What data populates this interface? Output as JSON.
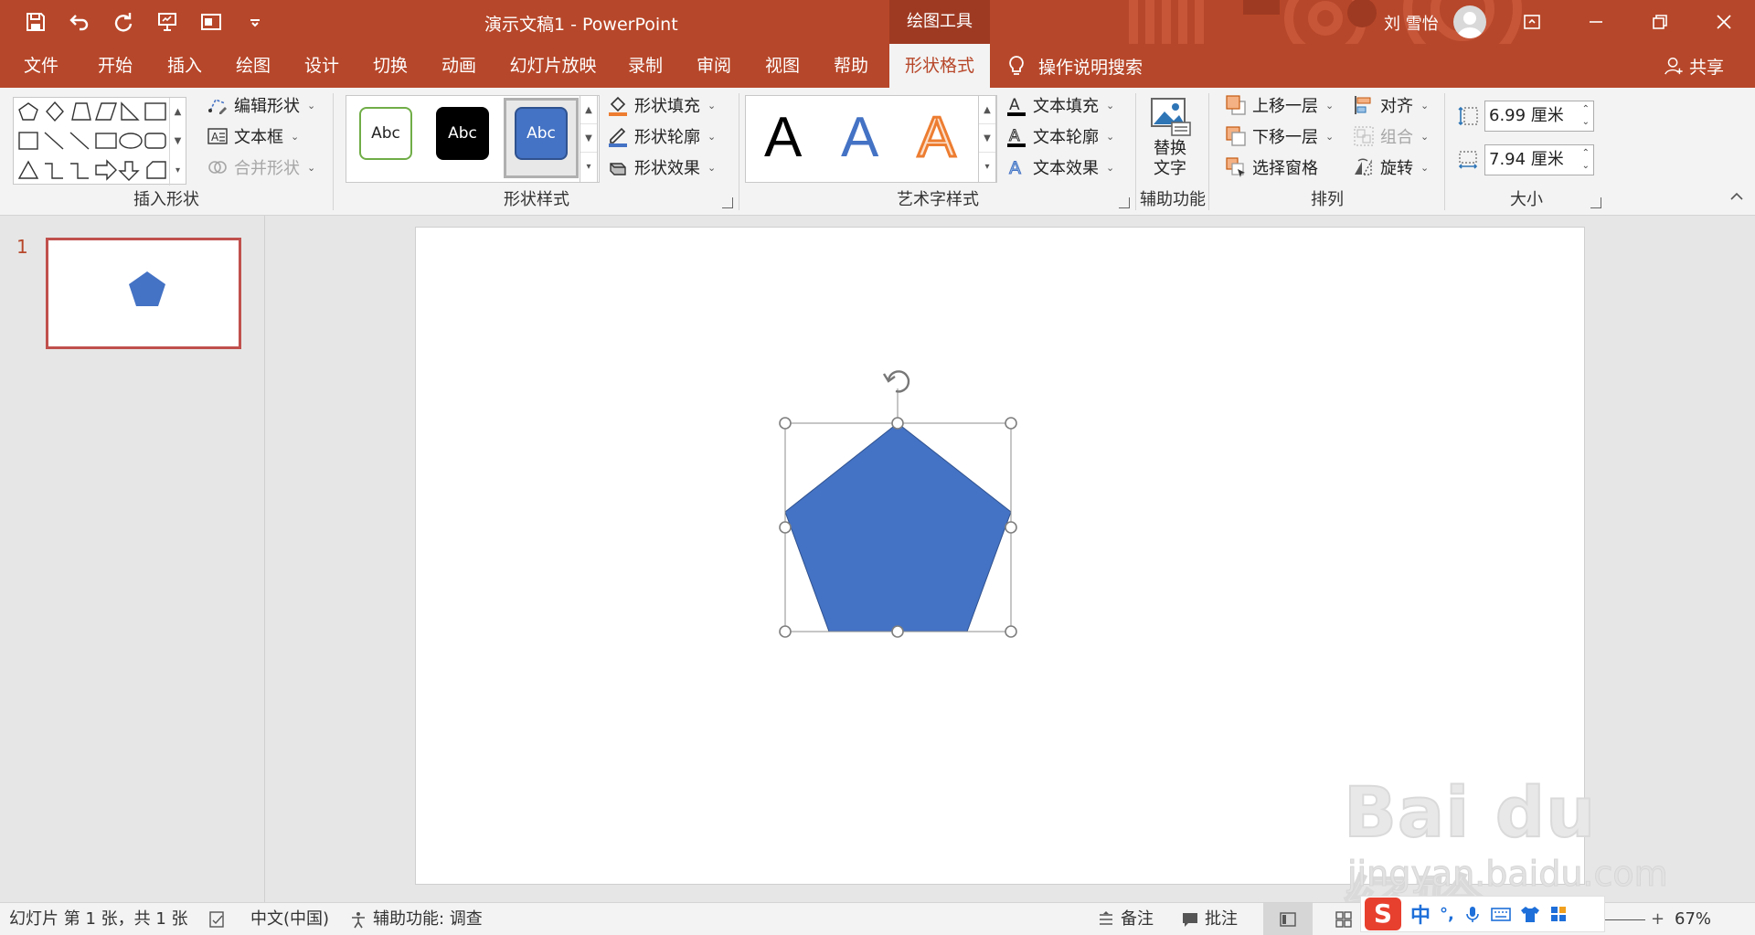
{
  "window": {
    "title": "演示文稿1  -  PowerPoint",
    "contextual_tab_group": "绘图工具",
    "user_name": "刘 雪怡"
  },
  "tabs": [
    {
      "label": "文件"
    },
    {
      "label": "开始"
    },
    {
      "label": "插入"
    },
    {
      "label": "绘图"
    },
    {
      "label": "设计"
    },
    {
      "label": "切换"
    },
    {
      "label": "动画"
    },
    {
      "label": "幻灯片放映"
    },
    {
      "label": "录制"
    },
    {
      "label": "审阅"
    },
    {
      "label": "视图"
    },
    {
      "label": "帮助"
    },
    {
      "label": "形状格式",
      "active": true
    }
  ],
  "tell_me": "操作说明搜索",
  "share": "共享",
  "ribbon": {
    "insert_shapes": {
      "label": "插入形状",
      "edit_shape": "编辑形状",
      "text_box": "文本框",
      "merge_shapes": "合并形状"
    },
    "shape_styles": {
      "label": "形状样式",
      "swatch_text": "Abc",
      "fill": "形状填充",
      "outline": "形状轮廓",
      "effects": "形状效果"
    },
    "wordart_styles": {
      "label": "艺术字样式",
      "letter": "A",
      "text_fill": "文本填充",
      "text_outline": "文本轮廓",
      "text_effects": "文本效果"
    },
    "accessibility": {
      "label": "辅助功能",
      "alt_text_line1": "替换",
      "alt_text_line2": "文字"
    },
    "arrange": {
      "label": "排列",
      "bring_forward": "上移一层",
      "send_backward": "下移一层",
      "selection_pane": "选择窗格",
      "align": "对齐",
      "group": "组合",
      "rotate": "旋转"
    },
    "size": {
      "label": "大小",
      "height": "6.99 厘米",
      "width": "7.94 厘米"
    }
  },
  "thumbnails": [
    {
      "number": "1"
    }
  ],
  "status": {
    "slide_info": "幻灯片 第 1 张，共 1 张",
    "language": "中文(中国)",
    "accessibility": "辅助功能: 调查",
    "notes": "备注",
    "comments": "批注",
    "zoom": "67%"
  },
  "ime": {
    "mode": "中",
    "punct": "°,"
  },
  "watermark": {
    "main": "Bai du 经验",
    "sub": "jingyan.baidu.com"
  },
  "colors": {
    "accent": "#b7472a",
    "shape_fill": "#4472c4",
    "wordart_blue": "#4472c4",
    "wordart_orange": "#ed7d31"
  }
}
